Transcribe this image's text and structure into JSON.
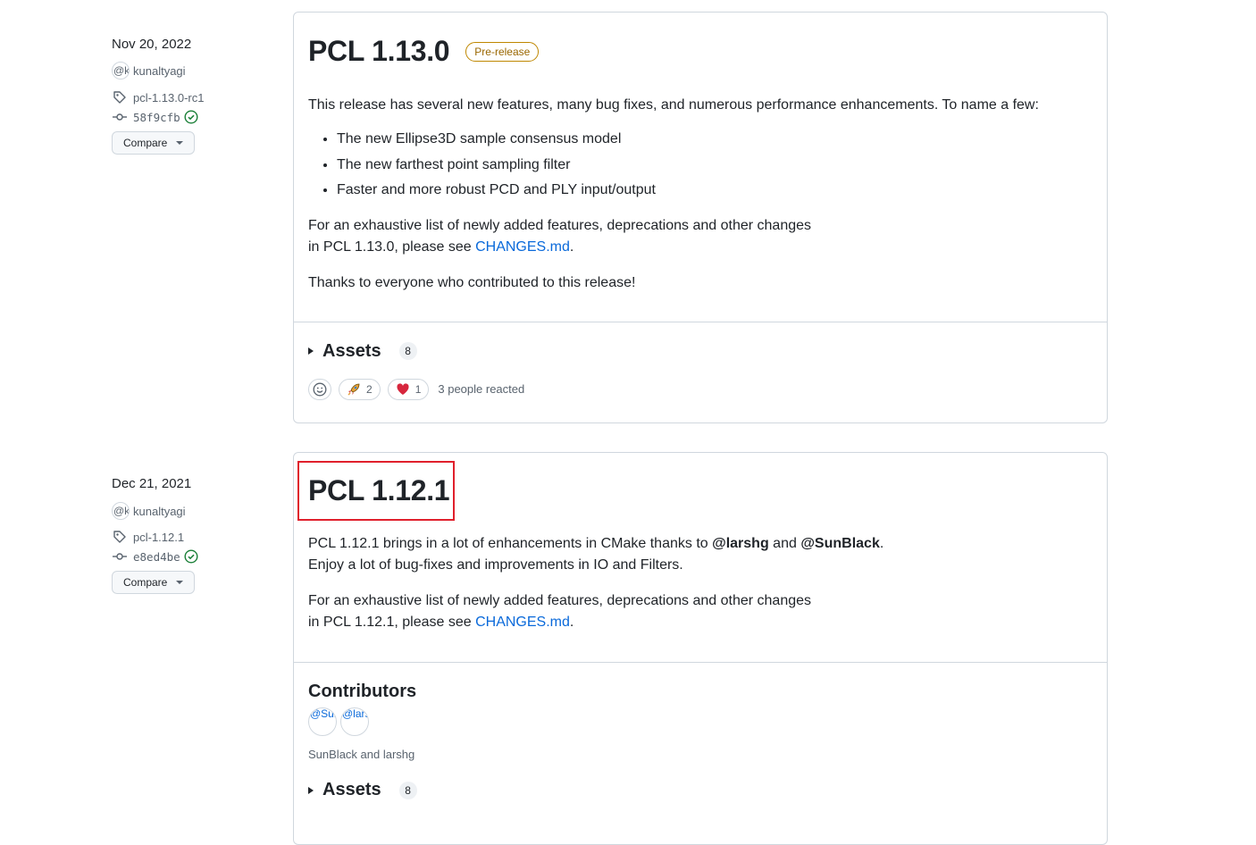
{
  "releases": [
    {
      "date": "Nov 20, 2022",
      "author_avatar": "@k",
      "author": "kunaltyagi",
      "tag": "pcl-1.13.0-rc1",
      "commit": "58f9cfb",
      "compare_label": "Compare",
      "title": "PCL 1.13.0",
      "badge": "Pre-release",
      "intro": "This release has several new features, many bug fixes, and numerous performance enhancements. To name a few:",
      "bullets": [
        "The new Ellipse3D sample consensus model",
        "The new farthest point sampling filter",
        "Faster and more robust PCD and PLY input/output"
      ],
      "changes_line1": "For an exhaustive list of newly added features, deprecations and other changes",
      "changes_line2_prefix": "in PCL 1.13.0, please see ",
      "changes_link": "CHANGES.md",
      "changes_suffix": ".",
      "thanks": "Thanks to everyone who contributed to this release!",
      "assets_label": "Assets",
      "assets_count": "8",
      "reactions": [
        {
          "icon": "rocket-icon",
          "count": "2"
        },
        {
          "icon": "heart-icon",
          "count": "1"
        }
      ],
      "reacted_text": "3 people reacted"
    },
    {
      "date": "Dec 21, 2021",
      "author_avatar": "@k",
      "author": "kunaltyagi",
      "tag": "pcl-1.12.1",
      "commit": "e8ed4be",
      "compare_label": "Compare",
      "title": "PCL 1.12.1",
      "intro_prefix": "PCL 1.12.1 brings in a lot of enhancements in CMake thanks to ",
      "mention1": "@larshg",
      "intro_and": " and ",
      "mention2": "@SunBlack",
      "intro_suffix": ".",
      "intro_line2": "Enjoy a lot of bug-fixes and improvements in IO and Filters.",
      "changes_line1": "For an exhaustive list of newly added features, deprecations and other changes",
      "changes_line2_prefix": "in PCL 1.12.1, please see ",
      "changes_link": "CHANGES.md",
      "changes_suffix": ".",
      "contributors_title": "Contributors",
      "contributor_avatars": [
        "@SunBlack",
        "@larshg"
      ],
      "contributors_text": "SunBlack and larshg",
      "assets_label": "Assets",
      "assets_count": "8"
    }
  ],
  "colors": {
    "accent": "#0969da",
    "prerelease": "#9a6700",
    "highlight": "#e0202c",
    "verified": "#1a7f37"
  }
}
